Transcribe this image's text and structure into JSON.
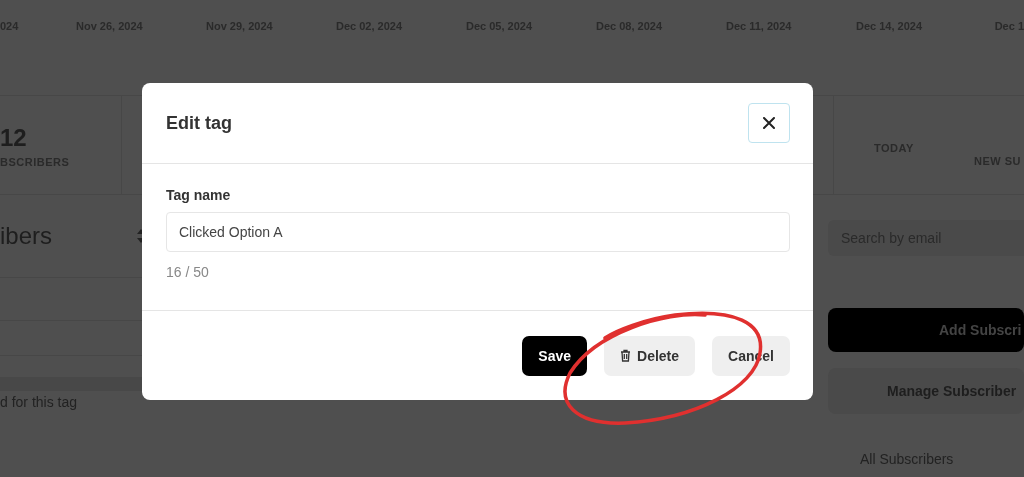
{
  "chart_axis": {
    "labels": [
      "024",
      "Nov 26, 2024",
      "Nov 29, 2024",
      "Dec 02, 2024",
      "Dec 05, 2024",
      "Dec 08, 2024",
      "Dec 11, 2024",
      "Dec 14, 2024",
      "Dec 1"
    ]
  },
  "stats": {
    "left": {
      "value": "12",
      "label": "BSCRIBERS"
    },
    "right": {
      "period": "TODAY",
      "label": "NEW SU"
    }
  },
  "list": {
    "heading": "ibers",
    "empty_text": "d for this tag"
  },
  "sidebar": {
    "search": {
      "placeholder": "Search by email"
    },
    "add_button": "Add Subscri",
    "manage_button": "Manage Subscriber",
    "nav_item": "All Subscribers"
  },
  "dialog": {
    "title": "Edit tag",
    "field_label": "Tag name",
    "field_value": "Clicked Option A",
    "counter": "16 / 50",
    "buttons": [
      {
        "kind": "primary",
        "label": "Save"
      },
      {
        "kind": "delete",
        "label": "Delete"
      },
      {
        "kind": "secondary",
        "label": "Cancel"
      }
    ]
  },
  "highlight": {
    "kind": "ellipse",
    "color": "#e0302f"
  }
}
